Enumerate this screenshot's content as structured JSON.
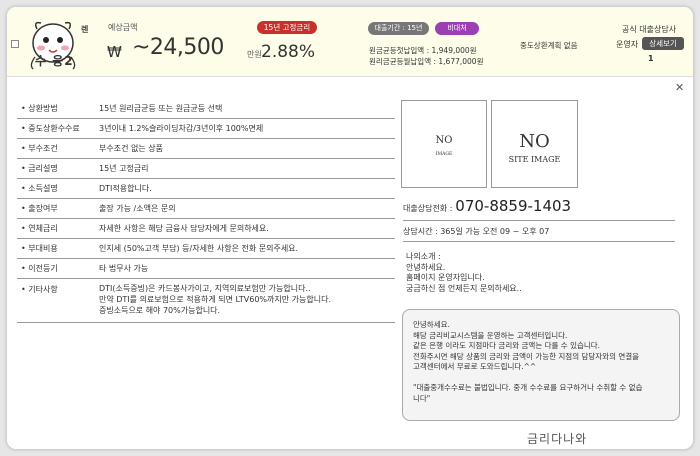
{
  "header": {
    "mascot_text_top": "렌",
    "mascot_text_bottom": "수 융2",
    "amount_label": "예상금액",
    "currency_symbol": "₩",
    "amount_value": "~24,500",
    "amount_unit": "만원",
    "rate_badge": "15년 고정금리",
    "rate_value": "2.88%",
    "badge_period": "대출기간 : 15년",
    "badge_visit": "비대처",
    "monthly_payment_first": "원금균등첫납입액 : 1,949,000원",
    "monthly_payment_equal": "원리금균등월납입액 : 1,677,000원",
    "early_repayment_plan": "중도상환계획 없음",
    "official_label": "공식 대출상담사",
    "operator_label": "운영자",
    "detail_button": "상세보기",
    "count": "1"
  },
  "close_symbol": "✕",
  "details": [
    {
      "label": "• 상환방법",
      "value": "15년 원리금균등 또는 원금균등 선택"
    },
    {
      "label": "• 중도상환수수료",
      "value": "3년이내 1.2%슬라이딩차감/3년이후 100%면제"
    },
    {
      "label": "• 부수조건",
      "value": "부수조건 없는 상품"
    },
    {
      "label": "• 금리설명",
      "value": "15년 고정금리"
    },
    {
      "label": "• 소득설명",
      "value": "DTI적용합니다."
    },
    {
      "label": "• 출장여부",
      "value": "출장 가능 /소액은 문의"
    },
    {
      "label": "• 연체금리",
      "value": "자세한 사항은 해당 금융사 담당자에게 문의하세요."
    },
    {
      "label": "• 부대비용",
      "value": "인지세 (50%고객 부담) 등/자세한 사항은 전화 문의주세요."
    },
    {
      "label": "• 이전등기",
      "value": "타 법무사 가능"
    },
    {
      "label": "• 기타사항",
      "value": "DTI(소득증빙)은 카드봉사가이고, 지역의료보험만 가능합니다..\n만약 DTI를 의료보험으로 적용하게 되면 LTV60%까지만 가능합니다.\n증빙소득으로 해야 70%가능합니다."
    }
  ],
  "images": {
    "small_line1": "NO",
    "small_line2": "IMAGE",
    "big_line1": "NO",
    "big_line2": "SITE IMAGE"
  },
  "contact": {
    "phone_label": "대출상담전화 :",
    "phone_number": "070-8859-1403",
    "hours": "상담시간 : 365일 가능 오전 09 ~ 오후 07",
    "intro": "나의소개 :\n안녕하세요.\n홈페이지 운영자입니다.\n궁금하신 점 언제든지 문의하세요.."
  },
  "notice": "안녕하세요.\n해당 금리비교시스템을 운영하는 고객센터입니다.\n같은 은행 이라도 지점마다 금리와 금액는 다를 수 있습니다.\n전화주시면 해당 상품의 금리와 금액이 가능한 지점의 담당자와의 연결을\n고객센터에서 무료로 도와드립니다.^^\n\n\"대출중개수수료는 불법입니다. 중개 수수료를 요구하거나 수취할 수 없습\n니다\"",
  "watermark": "금리다나와",
  "colors": {
    "header_bg": "#fdfde9",
    "rate_badge": "#c9302c",
    "period_badge": "#777777",
    "visit_badge": "#9b3fb3",
    "detail_button": "#555555"
  }
}
